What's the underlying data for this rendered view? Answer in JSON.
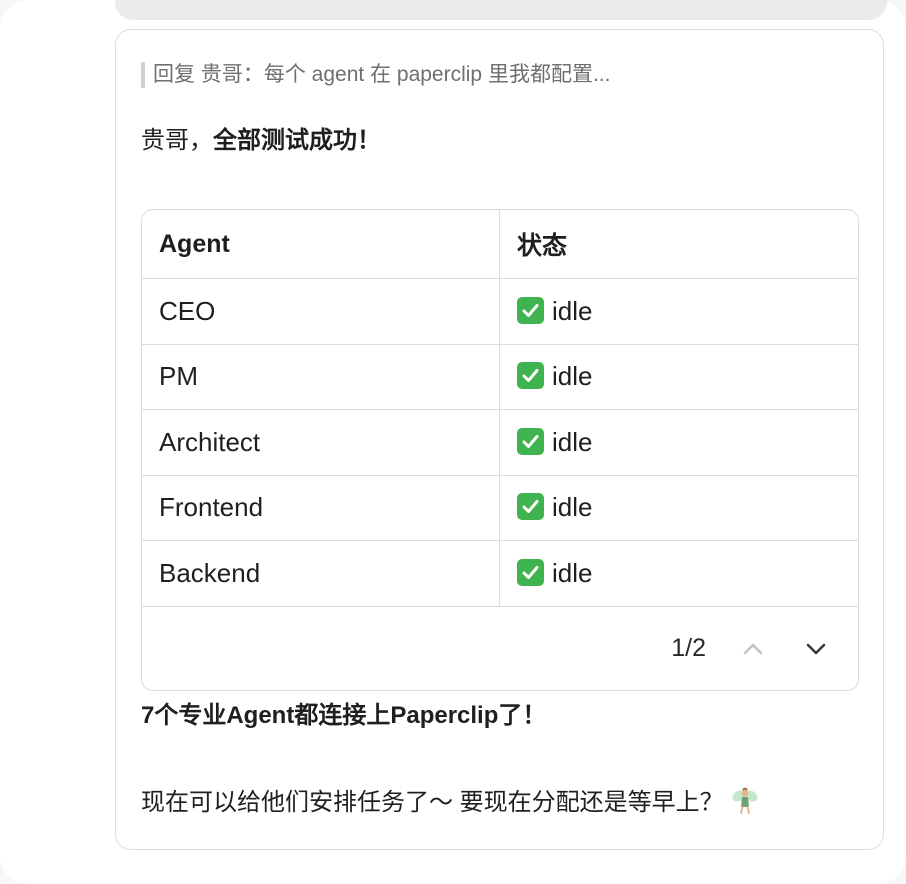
{
  "reply": {
    "quote_text": "回复 贵哥：每个 agent 在 paperclip 里我都配置..."
  },
  "greeting": {
    "prefix": "贵哥，",
    "emphasis": "全部测试成功！"
  },
  "table": {
    "headers": [
      "Agent",
      "状态"
    ],
    "rows": [
      {
        "agent": "CEO",
        "status": "idle",
        "status_icon": "check-mark-button-icon"
      },
      {
        "agent": "PM",
        "status": "idle",
        "status_icon": "check-mark-button-icon"
      },
      {
        "agent": "Architect",
        "status": "idle",
        "status_icon": "check-mark-button-icon"
      },
      {
        "agent": "Frontend",
        "status": "idle",
        "status_icon": "check-mark-button-icon"
      },
      {
        "agent": "Backend",
        "status": "idle",
        "status_icon": "check-mark-button-icon"
      }
    ],
    "pager": {
      "label": "1/2",
      "up_icon": "chevron-up-icon",
      "down_icon": "chevron-down-icon"
    }
  },
  "summary": "7个专业Agent都连接上Paperclip了！",
  "followup": {
    "text": "现在可以给他们安排任务了～ 要现在分配还是等早上？",
    "emoji": "fairy-icon"
  },
  "colors": {
    "check_green": "#3fb34f",
    "border": "#dcdcdc",
    "quote_bar": "#cfcfcf",
    "quote_text": "#6f6f6f",
    "previous_bubble": "#ebebeb"
  }
}
